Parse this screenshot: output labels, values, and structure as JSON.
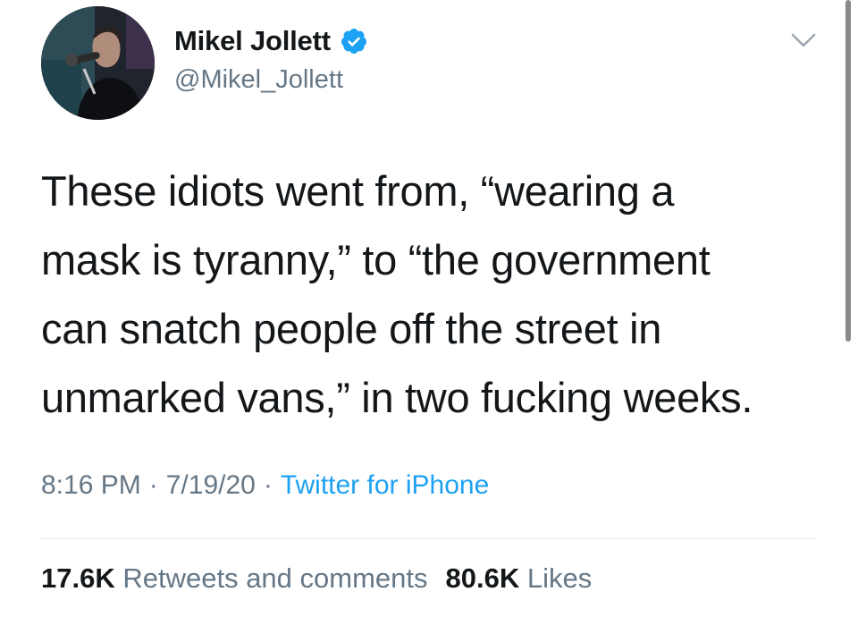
{
  "tweet": {
    "author": {
      "display_name": "Mikel Jollett",
      "handle": "@Mikel_Jollett",
      "verified": true,
      "avatar_icon": "profile-photo"
    },
    "text": "These idiots went from, “wearing a\nmask is tyranny,” to “the government\ncan snatch people off the street in\nunmarked vans,” in two fucking weeks.",
    "time": "8:16 PM",
    "date": "7/19/20",
    "separator": "·",
    "source": "Twitter for iPhone",
    "stats": {
      "retweets_count": "17.6K",
      "retweets_label": "Retweets and comments",
      "likes_count": "80.6K",
      "likes_label": "Likes"
    }
  },
  "icons": {
    "verified": "verified-badge-icon",
    "menu": "chevron-down-icon"
  },
  "colors": {
    "text_primary": "#14171a",
    "text_secondary": "#657786",
    "link": "#1da1f2",
    "verified": "#1da1f2",
    "divider": "#e1e8ed"
  }
}
